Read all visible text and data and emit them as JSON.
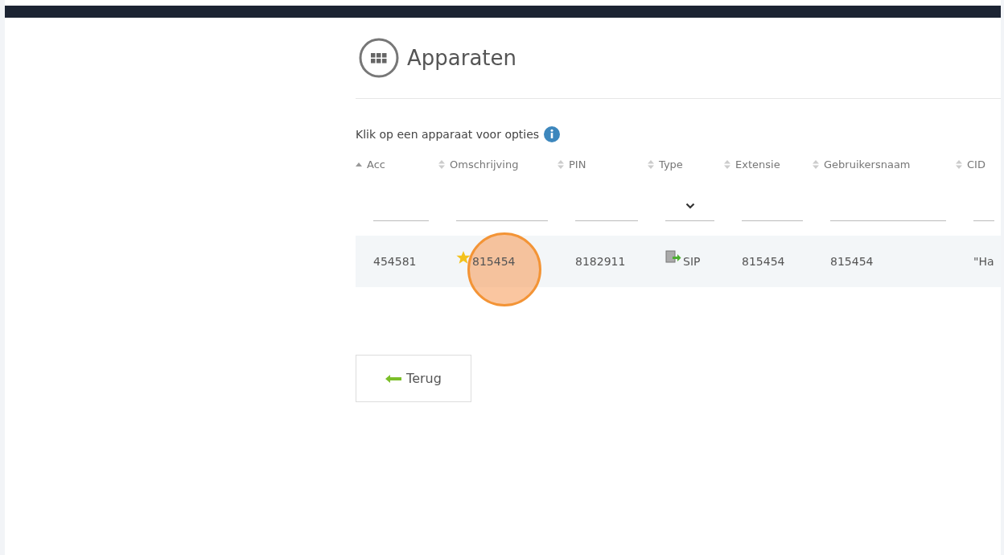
{
  "title": "Apparaten",
  "hint": "Klik op een apparaat voor opties",
  "columns": [
    {
      "label": "Acc",
      "sorted": true,
      "kind": "text"
    },
    {
      "label": "Omschrijving",
      "sorted": false,
      "kind": "text"
    },
    {
      "label": "PIN",
      "sorted": false,
      "kind": "text"
    },
    {
      "label": "Type",
      "sorted": false,
      "kind": "select"
    },
    {
      "label": "Extensie",
      "sorted": false,
      "kind": "text"
    },
    {
      "label": "Gebruikersnaam",
      "sorted": false,
      "kind": "text"
    },
    {
      "label": "CID",
      "sorted": false,
      "kind": "text"
    }
  ],
  "rows": [
    {
      "cells": [
        {
          "text": "454581",
          "kind": "plain"
        },
        {
          "text": "815454",
          "kind": "starred",
          "click_marker": true
        },
        {
          "text": "8182911",
          "kind": "plain"
        },
        {
          "text": "SIP",
          "kind": "type"
        },
        {
          "text": "815454",
          "kind": "plain"
        },
        {
          "text": "815454",
          "kind": "plain"
        },
        {
          "text": "\"Ha",
          "kind": "plain"
        }
      ]
    }
  ],
  "back_button": "Terug"
}
